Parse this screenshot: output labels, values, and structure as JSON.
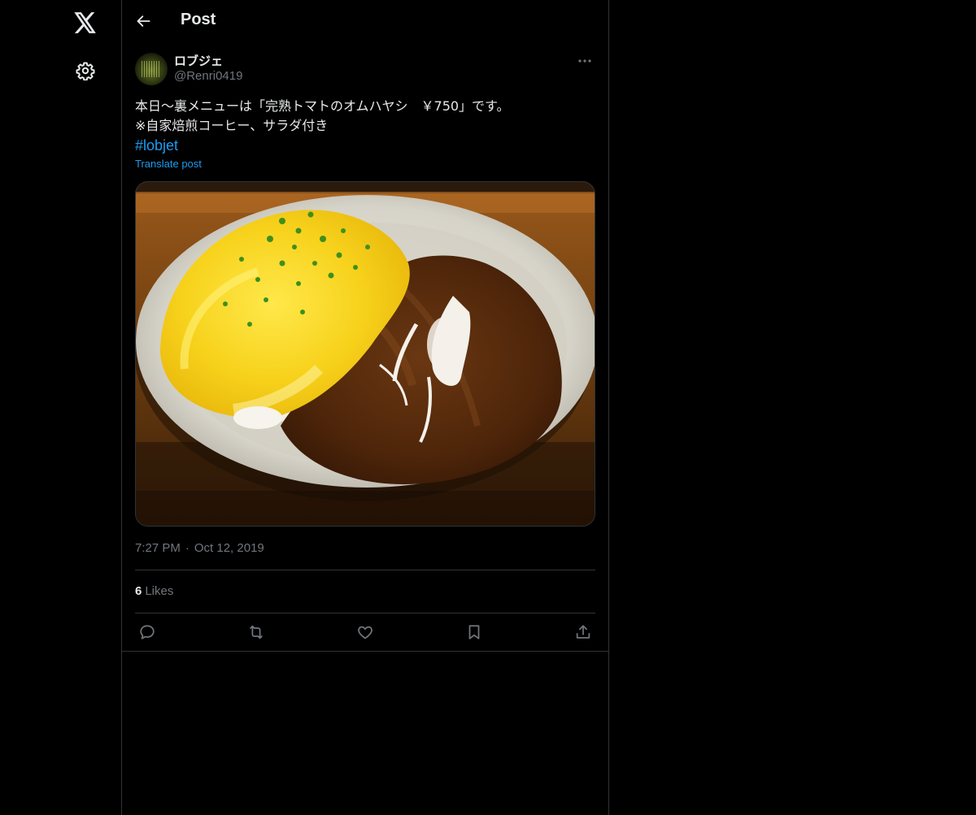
{
  "header": {
    "title": "Post"
  },
  "post": {
    "author": {
      "display_name": "ロブジェ",
      "handle": "@Renri0419"
    },
    "text_lines": [
      "本日〜裏メニューは「完熟トマトのオムハヤシ　￥750」です。",
      "※自家焙煎コーヒー、サラダ付き"
    ],
    "hashtag": "#lobjet",
    "translate_label": "Translate post",
    "time": "7:27 PM",
    "separator": "·",
    "date": "Oct 12, 2019",
    "likes_count": "6",
    "likes_label": "Likes"
  },
  "icons": {
    "nav": [
      "x-logo-icon",
      "gear-icon"
    ],
    "header": [
      "back-arrow-icon"
    ],
    "post": [
      "more-icon"
    ],
    "actions": [
      "reply-icon",
      "repost-icon",
      "like-icon",
      "bookmark-icon",
      "share-icon"
    ]
  },
  "colors": {
    "background": "#000000",
    "text": "#e7e9ea",
    "secondary_text": "#71767b",
    "accent": "#1d9bf0",
    "border": "#2f3336"
  }
}
